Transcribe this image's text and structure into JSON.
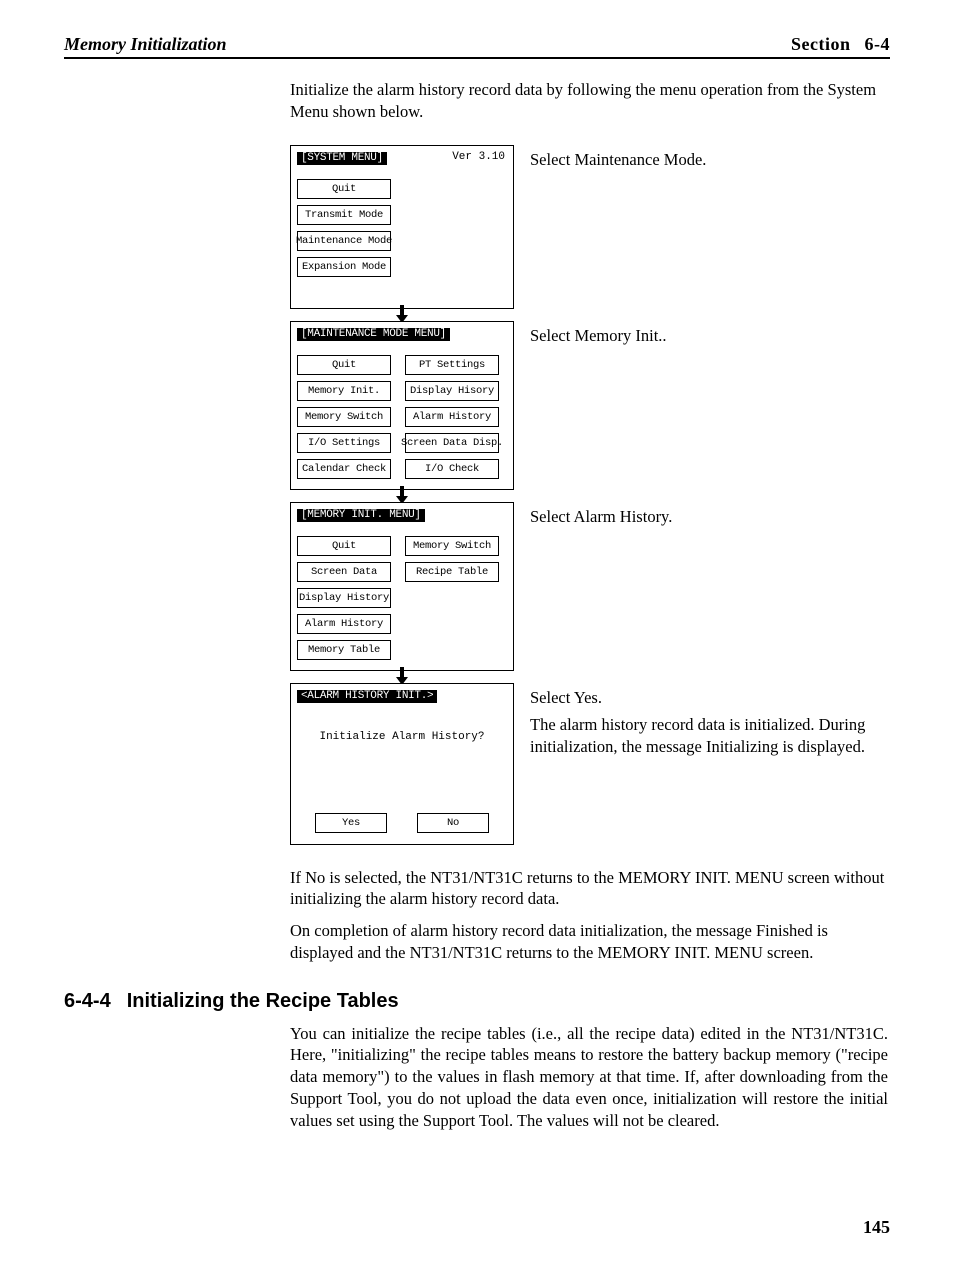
{
  "header": {
    "left": "Memory Initialization",
    "section_label": "Section",
    "section_num": "6-4"
  },
  "intro": "Initialize the alarm history record data by following the menu operation from the System Menu shown below.",
  "screens": {
    "system_menu": {
      "title": "[SYSTEM MENU]",
      "version": "Ver 3.10",
      "buttons": [
        "Quit",
        "Transmit Mode",
        "Maintenance Mode",
        "Expansion Mode"
      ],
      "desc": "Select Maintenance Mode."
    },
    "maint_menu": {
      "title": "[MAINTENANCE MODE MENU]",
      "left": [
        "Quit",
        "Memory Init.",
        "Memory Switch",
        "I/O Settings",
        "Calendar Check"
      ],
      "right": [
        "PT Settings",
        "Display Hisory",
        "Alarm History",
        "Screen Data Disp.",
        "I/O Check"
      ],
      "desc": "Select Memory Init.."
    },
    "mem_init_menu": {
      "title": "[MEMORY INIT. MENU]",
      "left": [
        "Quit",
        "Screen Data",
        "Display History",
        "Alarm History",
        "Memory Table"
      ],
      "right": [
        "Memory Switch",
        "Recipe Table"
      ],
      "desc": "Select Alarm History."
    },
    "alarm_init": {
      "title": "<ALARM HISTORY INIT.>",
      "question": "Initialize Alarm History?",
      "yes": "Yes",
      "no": "No",
      "desc1": "Select Yes.",
      "desc2": "The alarm history record data is initialized. During initialization, the message Initializing is displayed."
    }
  },
  "after": {
    "p1": "If No is selected, the NT31/NT31C returns to the MEMORY INIT. MENU screen without initializing the alarm history record data.",
    "p2": "On completion of alarm history record data initialization, the message Finished is displayed and the NT31/NT31C returns to the MEMORY INIT. MENU screen."
  },
  "subsection": {
    "num": "6-4-4",
    "title": "Initializing the Recipe Tables",
    "body": "You can initialize the recipe tables (i.e., all the recipe data) edited in the NT31/NT31C. Here, \"initializing\" the recipe tables means to restore the battery backup memory (\"recipe data memory\") to the values in flash memory at that time. If, after downloading from the Support Tool, you do not upload the data even once, initialization will restore the initial values set using the Support Tool. The values will not be cleared."
  },
  "page_number": "145"
}
